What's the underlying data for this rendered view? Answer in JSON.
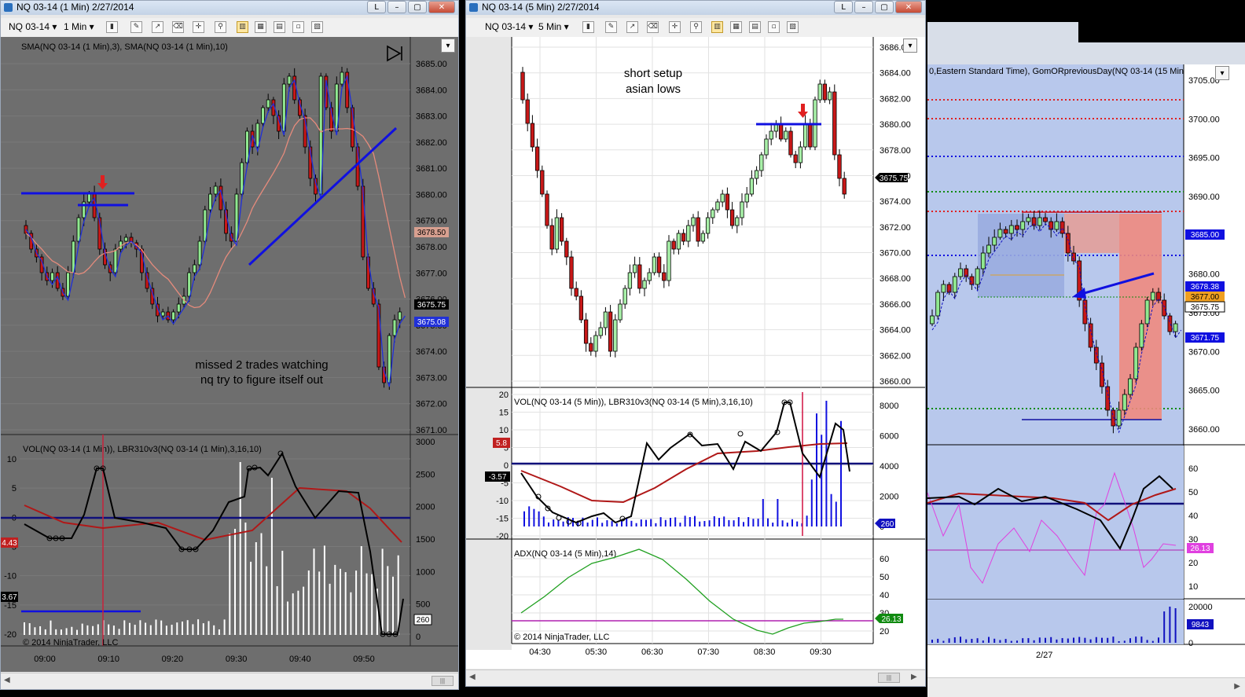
{
  "win1": {
    "title": "NQ 03-14 (1 Min)  2/27/2014",
    "instrument": "NQ 03-14",
    "interval": "1 Min",
    "price_indicator_label": "SMA(NQ 03-14 (1 Min),3), SMA(NQ 03-14 (1 Min),10)",
    "annotation": [
      "missed 2 trades watching",
      "nq try to figure itself out"
    ],
    "price_axis": [
      "3685.00",
      "3684.00",
      "3683.00",
      "3682.00",
      "3681.00",
      "3680.00",
      "3679.00",
      "3678.00",
      "3677.00",
      "3676.00",
      "3675.00",
      "3674.00",
      "3673.00",
      "3672.00",
      "3671.00"
    ],
    "price_markers": {
      "sma10": "3678.50",
      "last": "3675.75",
      "sma3": "3675.08"
    },
    "osc_label": "VOL(NQ 03-14 (1 Min)), LBR310v3(NQ 03-14 (1 Min),3,16,10)",
    "osc_left_axis": [
      "10",
      "5",
      "0",
      "-5",
      "-10",
      "-15",
      "-20"
    ],
    "osc_right_axis": [
      "3000",
      "2500",
      "2000",
      "1500",
      "1000",
      "500",
      "0"
    ],
    "osc_markers": {
      "left1": "4.43",
      "left2": "3.67",
      "vol": "260"
    },
    "copyright": "© 2014 NinjaTrader, LLC",
    "time_axis": [
      "09:00",
      "09:10",
      "09:20",
      "09:30",
      "09:40",
      "09:50"
    ]
  },
  "win2": {
    "title": "NQ 03-14 (5 Min)  2/27/2014",
    "instrument": "NQ 03-14",
    "interval": "5 Min",
    "annotation": [
      "short setup",
      "asian lows"
    ],
    "price_axis": [
      "3686.00",
      "3684.00",
      "3682.00",
      "3680.00",
      "3678.00",
      "3676.00",
      "3674.00",
      "3672.00",
      "3670.00",
      "3668.00",
      "3666.00",
      "3664.00",
      "3662.00",
      "3660.00"
    ],
    "price_markers": {
      "last": "3675.75"
    },
    "osc_label": "VOL(NQ 03-14 (5 Min)), LBR310v3(NQ 03-14 (5 Min),3,16,10)",
    "osc_left_axis": [
      "20",
      "15",
      "10",
      "5",
      "0",
      "-5",
      "-10",
      "-15",
      "-20"
    ],
    "osc_right_axis": [
      "8000",
      "6000",
      "4000",
      "2000",
      "0"
    ],
    "osc_markers": {
      "left1": "5.8",
      "left2": "-3.57",
      "vol": "260"
    },
    "adx_label": "ADX(NQ 03-14 (5 Min),14)",
    "adx_axis": [
      "60",
      "50",
      "40",
      "30",
      "20"
    ],
    "adx_marker": "26.13",
    "copyright": "© 2014 NinjaTrader, LLC",
    "time_axis": [
      "04:30",
      "05:30",
      "06:30",
      "07:30",
      "08:30",
      "09:30"
    ]
  },
  "win3": {
    "indicator_label": "0,Eastern Standard Time), GomORpreviousDay(NQ 03-14 (15 Min",
    "price_axis": [
      "3705.00",
      "3700.00",
      "3695.00",
      "3690.00",
      "3685.00",
      "3680.00",
      "3675.00",
      "3670.00",
      "3665.00",
      "3660.00"
    ],
    "price_markers": {
      "m1": "3685.00",
      "m2": "3678.38",
      "m3": "3677.00",
      "m4": "3675.75",
      "m5": "3671.75"
    },
    "osc_axis": [
      "60",
      "50",
      "40",
      "30",
      "20",
      "10"
    ],
    "osc_marker": "26.13",
    "vol_axis": [
      "20000",
      "10000",
      "0"
    ],
    "vol_marker": "9843",
    "date_label": "2/27"
  },
  "colors": {
    "bull": "#90e890",
    "bear": "#c81818",
    "guide_blue": "#1010e0",
    "accent_red": "#d01040"
  }
}
